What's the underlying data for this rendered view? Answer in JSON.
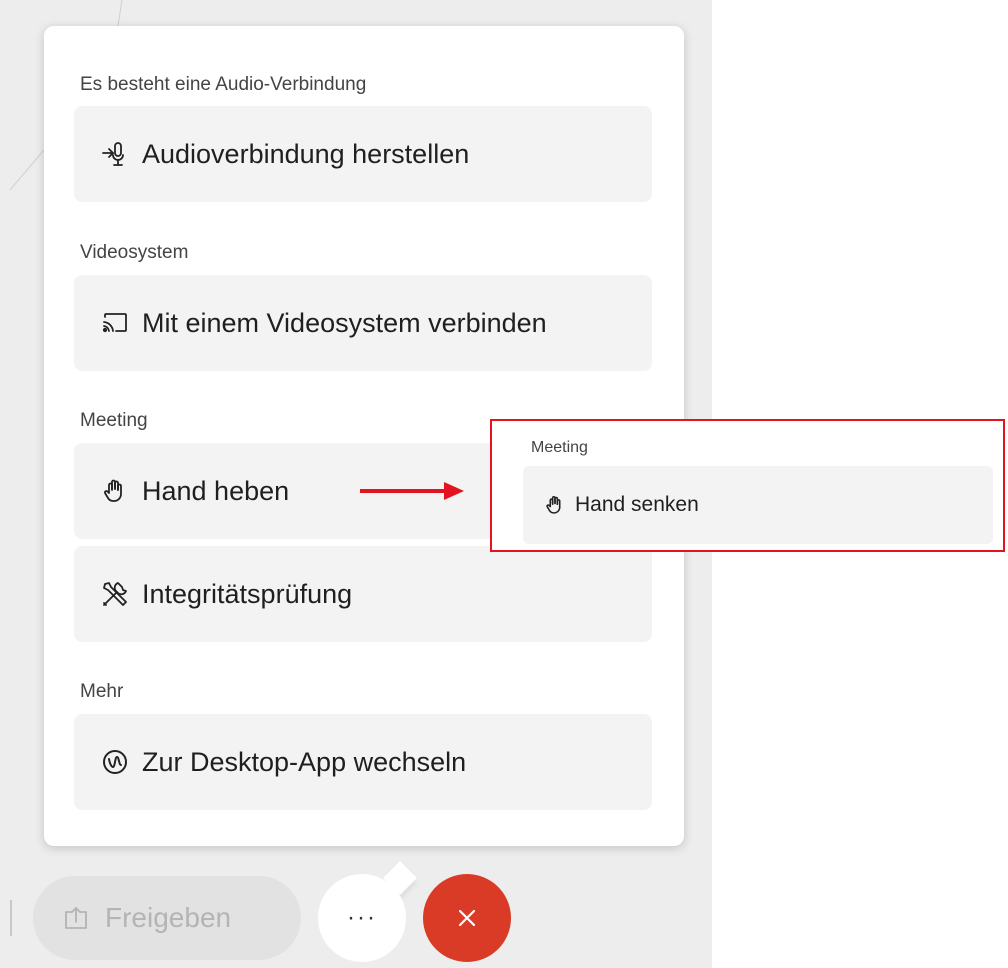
{
  "menu": {
    "sections": [
      {
        "label": "Es besteht eine Audio-Verbindung",
        "items": [
          {
            "label": "Audioverbindung herstellen",
            "icon": "audio-connect-icon"
          }
        ]
      },
      {
        "label": "Videosystem",
        "items": [
          {
            "label": "Mit einem Videosystem verbinden",
            "icon": "cast-icon"
          }
        ]
      },
      {
        "label": "Meeting",
        "items": [
          {
            "label": "Hand heben",
            "icon": "raise-hand-icon"
          },
          {
            "label": "Integritätsprüfung",
            "icon": "tools-icon"
          }
        ]
      },
      {
        "label": "Mehr",
        "items": [
          {
            "label": "Zur Desktop-App wechseln",
            "icon": "webex-icon"
          }
        ]
      }
    ]
  },
  "controls": {
    "share_label": "Freigeben",
    "more_label": "···",
    "close_label": "✕"
  },
  "callout": {
    "section_label": "Meeting",
    "item_label": "Hand senken",
    "icon": "lower-hand-icon",
    "border_color": "#e3141f",
    "arrow_color": "#e3141f"
  },
  "colors": {
    "close_button": "#da3b26",
    "menu_item_bg": "#f3f3f3"
  }
}
